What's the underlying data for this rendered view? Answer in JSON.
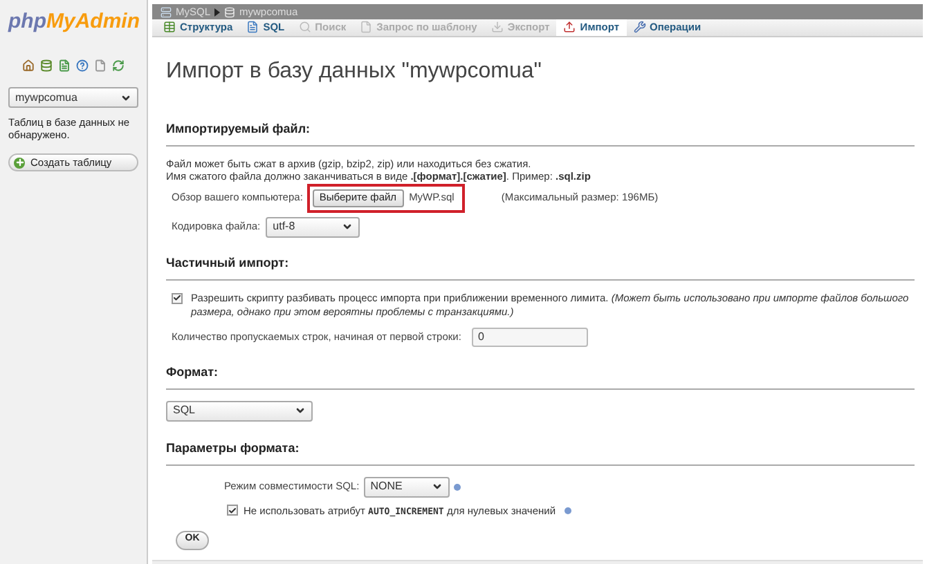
{
  "sidebar": {
    "logo": {
      "part1": "php",
      "part2": "MyAdmin"
    },
    "database_select": {
      "value": "mywpcomua"
    },
    "message": "Таблиц в базе данных не обнаружено.",
    "create_button": "Создать таблицу"
  },
  "breadcrumb": [
    "MySQL",
    "mywpcomua"
  ],
  "tabs": [
    {
      "label": "Структура",
      "selected": false,
      "disabled": false
    },
    {
      "label": "SQL",
      "selected": false,
      "disabled": false
    },
    {
      "label": "Поиск",
      "selected": false,
      "disabled": true
    },
    {
      "label": "Запрос по шаблону",
      "selected": false,
      "disabled": true
    },
    {
      "label": "Экспорт",
      "selected": false,
      "disabled": true
    },
    {
      "label": "Импорт",
      "selected": true,
      "disabled": false
    },
    {
      "label": "Операции",
      "selected": false,
      "disabled": false
    }
  ],
  "page_title": "Импорт в базу данных \"mywpcomua\"",
  "file_section": {
    "heading": "Импортируемый файл:",
    "hint_1": "Файл может быть сжат в архив (gzip, bzip2, zip) или находиться без сжатия.",
    "hint_2": "Имя сжатого файла должно заканчиваться в виде **.[формат].[сжатие]**. Пример: **.sql.zip**",
    "browse_label": "Обзор вашего компьютера:",
    "choose_button": "Выберите файл",
    "file_name": "MyWP.sql",
    "max_size": "(Максимальный размер: 196МБ)",
    "encoding_label": "Кодировка файла:",
    "encoding_value": "utf-8"
  },
  "partial_section": {
    "heading": "Частичный импорт:",
    "allow_interrupt": {
      "checked": true,
      "label": "Разрешить скрипту разбивать процесс импорта при приближении временного лимита. *(Может быть использовано при импорте файлов большого размера, однако при этом вероятны проблемы с транзакциями.)*"
    },
    "skip_label": "Количество пропускаемых строк, начиная от первой строки:",
    "skip_value": "0"
  },
  "format_section": {
    "heading": "Формат:",
    "format_value": "SQL"
  },
  "options_section": {
    "heading": "Параметры формата:",
    "compat_label": "Режим совместимости SQL:",
    "compat_value": "NONE",
    "no_auto_increment": {
      "checked": true,
      "before": "Не использовать атрибут",
      "code": "AUTO_INCREMENT",
      "after": "для нулевых значений"
    }
  },
  "ok_button": "OK"
}
